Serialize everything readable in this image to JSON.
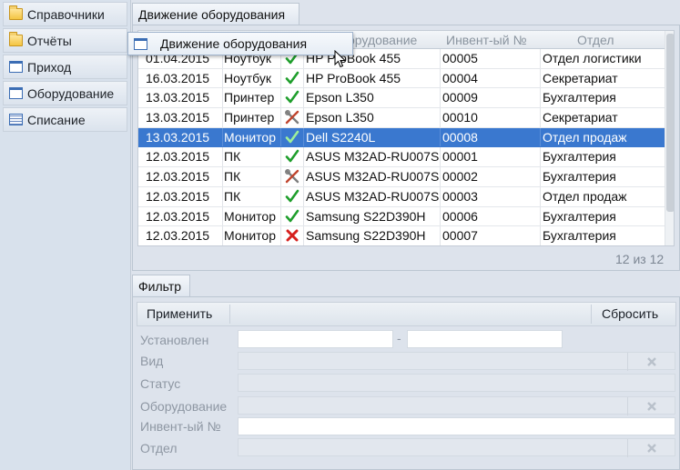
{
  "sidebar": {
    "items": [
      {
        "label": "Справочники",
        "icon": "folder-icon"
      },
      {
        "label": "Отчёты",
        "icon": "folder-icon"
      },
      {
        "label": "Приход",
        "icon": "window-icon"
      },
      {
        "label": "Оборудование",
        "icon": "window-icon"
      },
      {
        "label": "Списание",
        "icon": "sheet-icon"
      }
    ]
  },
  "main": {
    "tab_label": "Движение оборудования",
    "columns": {
      "equipment": "орудование",
      "inv": "Инвент-ый №",
      "dept": "Отдел"
    },
    "rows": [
      {
        "date": "01.04.2015",
        "kind": "Ноутбук",
        "status": "ok",
        "model": "HP ProBook 455",
        "inv": "00005",
        "dept": "Отдел логистики"
      },
      {
        "date": "16.03.2015",
        "kind": "Ноутбук",
        "status": "ok",
        "model": "HP ProBook 455",
        "inv": "00004",
        "dept": "Секретариат"
      },
      {
        "date": "13.03.2015",
        "kind": "Принтер",
        "status": "ok",
        "model": "Epson L350",
        "inv": "00009",
        "dept": "Бухгалтерия"
      },
      {
        "date": "13.03.2015",
        "kind": "Принтер",
        "status": "repair",
        "model": "Epson L350",
        "inv": "00010",
        "dept": "Секретариат"
      },
      {
        "date": "13.03.2015",
        "kind": "Монитор",
        "status": "ok",
        "model": "Dell S2240L",
        "inv": "00008",
        "dept": "Отдел продаж",
        "selected": true
      },
      {
        "date": "12.03.2015",
        "kind": "ПК",
        "status": "ok",
        "model": "ASUS M32AD-RU007S",
        "inv": "00001",
        "dept": "Бухгалтерия"
      },
      {
        "date": "12.03.2015",
        "kind": "ПК",
        "status": "repair",
        "model": "ASUS M32AD-RU007S",
        "inv": "00002",
        "dept": "Бухгалтерия"
      },
      {
        "date": "12.03.2015",
        "kind": "ПК",
        "status": "ok",
        "model": "ASUS M32AD-RU007S",
        "inv": "00003",
        "dept": "Отдел продаж"
      },
      {
        "date": "12.03.2015",
        "kind": "Монитор",
        "status": "ok",
        "model": "Samsung S22D390H",
        "inv": "00006",
        "dept": "Бухгалтерия"
      },
      {
        "date": "12.03.2015",
        "kind": "Монитор",
        "status": "writeoff",
        "model": "Samsung S22D390H",
        "inv": "00007",
        "dept": "Бухгалтерия"
      }
    ],
    "counter": "12 из 12"
  },
  "drag": {
    "label": "Движение оборудования"
  },
  "filter": {
    "tab_label": "Фильтр",
    "apply_label": "Применить",
    "reset_label": "Сбросить",
    "dash": "-",
    "fields": {
      "installed": "Установлен",
      "kind": "Вид",
      "status": "Статус",
      "equipment": "Оборудование",
      "inv": "Инвент-ый №",
      "dept": "Отдел"
    }
  },
  "colors": {
    "accent": "#3a78cf",
    "ok": "#1f9e2c",
    "writeoff": "#d6201e",
    "repair": "#7d7d7d"
  }
}
